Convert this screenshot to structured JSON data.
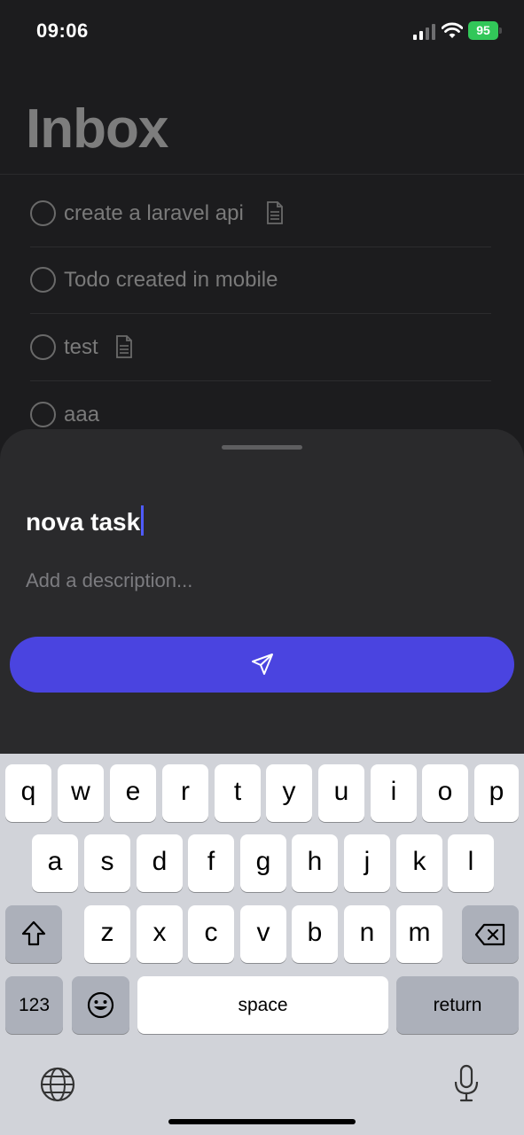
{
  "status_bar": {
    "time": "09:06",
    "battery_level": "95",
    "battery_color": "#32c759",
    "icons": [
      "signal-icon",
      "wifi-icon",
      "battery-icon"
    ]
  },
  "inbox": {
    "title": "Inbox",
    "items": [
      {
        "label": "create a laravel api",
        "has_note": true
      },
      {
        "label": "Todo created in mobile",
        "has_note": false
      },
      {
        "label": "test",
        "has_note": true
      },
      {
        "label": "aaa",
        "has_note": false
      }
    ]
  },
  "sheet": {
    "title_value": "nova task",
    "description_placeholder": "Add a description...",
    "send_icon": "send-icon",
    "accent_color": "#4a44e0"
  },
  "keyboard": {
    "row1": [
      "q",
      "w",
      "e",
      "r",
      "t",
      "y",
      "u",
      "i",
      "o",
      "p"
    ],
    "row2": [
      "a",
      "s",
      "d",
      "f",
      "g",
      "h",
      "j",
      "k",
      "l"
    ],
    "row3": [
      "z",
      "x",
      "c",
      "v",
      "b",
      "n",
      "m"
    ],
    "numbers_label": "123",
    "space_label": "space",
    "return_label": "return",
    "icons": [
      "shift-icon",
      "backspace-icon",
      "emoji-icon",
      "globe-icon",
      "microphone-icon"
    ]
  }
}
